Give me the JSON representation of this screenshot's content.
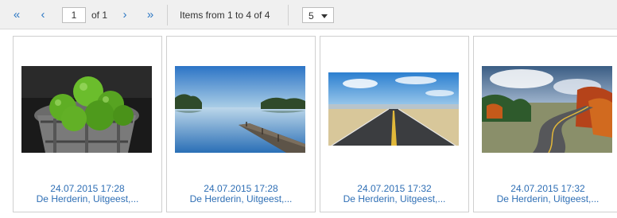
{
  "pager": {
    "first_icon": "double-chevron-left-icon",
    "prev_icon": "chevron-left-icon",
    "next_icon": "chevron-right-icon",
    "last_icon": "double-chevron-right-icon",
    "page_value": "1",
    "of_text": "of 1",
    "items_text": "Items from 1 to 4 of 4",
    "page_size": "5",
    "accent_color": "#2f79c4"
  },
  "cards": [
    {
      "date": "24.07.2015 17:28",
      "location": "De Herderin, Uitgeest,...",
      "image": "green-apples-in-bucket"
    },
    {
      "date": "24.07.2015 17:28",
      "location": "De Herderin, Uitgeest,...",
      "image": "lake-with-pier"
    },
    {
      "date": "24.07.2015 17:32",
      "location": "De Herderin, Uitgeest,...",
      "image": "straight-desert-road"
    },
    {
      "date": "24.07.2015 17:32",
      "location": "De Herderin, Uitgeest,...",
      "image": "winding-autumn-road"
    }
  ]
}
